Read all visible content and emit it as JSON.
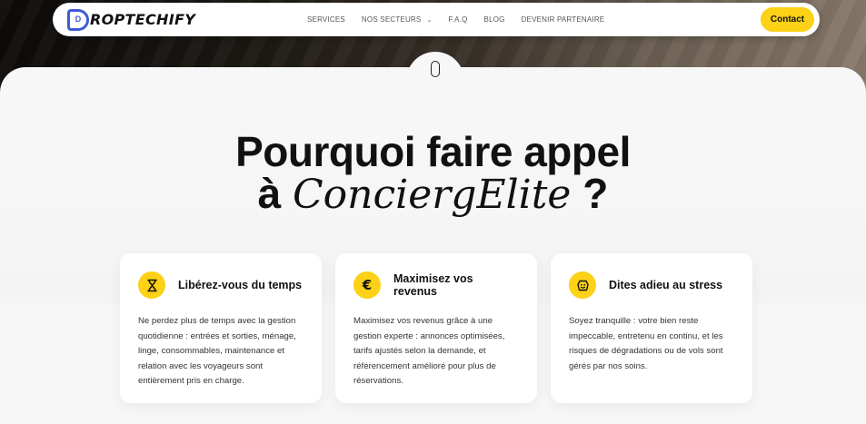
{
  "nav": {
    "logo_text": "ROPTECHIFY",
    "logo_letter": "D",
    "links": {
      "services": "SERVICES",
      "secteurs": "NOS SECTEURS",
      "faq": "F.A.Q",
      "blog": "BLOG",
      "partner": "DEVENIR PARTENAIRE"
    },
    "contact": "Contact"
  },
  "headline": {
    "line1": "Pourquoi faire appel",
    "line2_prefix": "à ",
    "brand": "ConciergElite",
    "line2_suffix": " ?"
  },
  "cards": [
    {
      "icon": "hourglass-icon",
      "title": "Libérez-vous du temps",
      "body": "Ne perdez plus de temps avec la gestion quotidienne : entrées et sorties, ménage, linge, consommables, maintenance et relation avec les voyageurs sont entièrement pris en charge."
    },
    {
      "icon": "euro-icon",
      "title": "Maximisez vos revenus",
      "body": "Maximisez vos revenus grâce à une gestion experte : annonces optimisées, tarifs ajustés selon la demande, et référencement amélioré pour plus de réservations."
    },
    {
      "icon": "relax-face-icon",
      "title": "Dites adieu au stress",
      "body": "Soyez tranquille : votre bien reste impeccable, entretenu en continu, et les risques de dégradations ou de vols sont gérés par nos soins."
    }
  ],
  "colors": {
    "accent": "#fcd116",
    "logo": "#3e5bd8"
  }
}
